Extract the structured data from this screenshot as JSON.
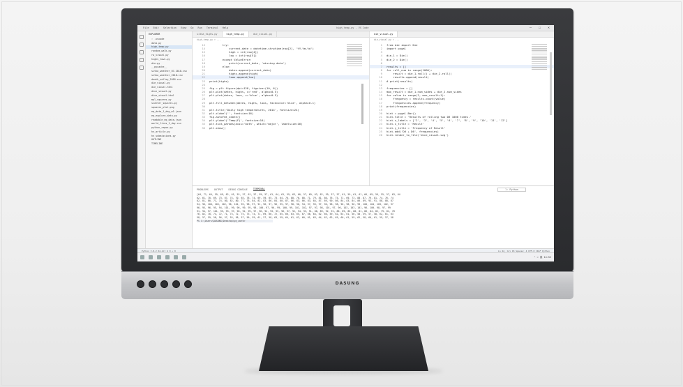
{
  "monitor": {
    "brand": "DASUNG",
    "buttons": [
      "",
      "",
      "",
      "",
      ""
    ]
  },
  "window": {
    "menu": [
      "File",
      "Edit",
      "Selection",
      "View",
      "Go",
      "Run",
      "Terminal",
      "Help"
    ],
    "title": "high_temp.py - VS Code",
    "controls": [
      "—",
      "☐",
      "✕"
    ]
  },
  "explorer": {
    "header": "EXPLORER",
    "items": [
      "› .vscode",
      "data.py",
      "high_temp.py",
      "random_walk.py",
      "rw_visual.py",
      "highs_lows.py",
      "die.py",
      "__pycache__",
      "sitka_weather_07-2018.csv",
      "sitka_weather_2018.csv",
      "death_valley_2018.csv",
      "die_visual.py",
      "die_visual.html",
      "dice_visual.py",
      "dice_visual.html",
      "mpl_squares.py",
      "scatter_squares.py",
      "squares_plot.png",
      "eq_data_1_day_m1.json",
      "eq_explore_data.py",
      "readable_eq_data.json",
      "world_fires_1_day.csv",
      "python_repos.py",
      "hn_article.py",
      "hn_submissions.py",
      "OUTLINE",
      "TIMELINE"
    ]
  },
  "editor_left": {
    "tabs": [
      "sitka_highs.py",
      "high_temp.py",
      "die_visual.py"
    ],
    "breadcrumb": "high_temp.py > ...",
    "lines": [
      {
        "n": "13",
        "t": "        try:"
      },
      {
        "n": "14",
        "t": "            current_date = datetime.strptime(row[2], '%Y-%m-%d')"
      },
      {
        "n": "15",
        "t": "            high = int(row[4])"
      },
      {
        "n": "16",
        "t": "            low = int(row[5])"
      },
      {
        "n": "17",
        "t": "        except ValueError:"
      },
      {
        "n": "18",
        "t": "            print(current_date, 'missing data')"
      },
      {
        "n": "19",
        "t": "        else:"
      },
      {
        "n": "20",
        "t": "            dates.append(current_date)"
      },
      {
        "n": "21",
        "t": "            highs.append(high)"
      },
      {
        "n": "22",
        "t": "            lows.append(low)"
      },
      {
        "n": "23",
        "t": "print(highs)"
      },
      {
        "n": "24",
        "t": ""
      },
      {
        "n": "25",
        "t": "fig = plt.figure(dpi=128, figsize=(10, 6))"
      },
      {
        "n": "26",
        "t": "plt.plot(dates, highs, c='red', alpha=0.5)"
      },
      {
        "n": "27",
        "t": "plt.plot(dates, lows, c='blue', alpha=0.5)"
      },
      {
        "n": "28",
        "t": ""
      },
      {
        "n": "29",
        "t": "plt.fill_between(dates, highs, lows, facecolor='blue', alpha=0.1)"
      },
      {
        "n": "30",
        "t": ""
      },
      {
        "n": "31",
        "t": "plt.title('Daily high temperatures, 2014', fontsize=24)"
      },
      {
        "n": "32",
        "t": "plt.xlabel('', fontsize=16)"
      },
      {
        "n": "33",
        "t": "fig.autofmt_xdate()"
      },
      {
        "n": "34",
        "t": "plt.ylabel('Temp(F)', fontsize=16)"
      },
      {
        "n": "35",
        "t": "plt.tick_params(axis='both', which='major', labelsize=16)"
      },
      {
        "n": "36",
        "t": "plt.show()"
      }
    ]
  },
  "editor_right": {
    "tabs": [
      "die_visual.py"
    ],
    "breadcrumb": "die_visual.py > ...",
    "lines": [
      {
        "n": "1",
        "t": "from die import Die"
      },
      {
        "n": "2",
        "t": "import pygal"
      },
      {
        "n": "3",
        "t": ""
      },
      {
        "n": "4",
        "t": "die_1 = Die()"
      },
      {
        "n": "5",
        "t": "die_2 = Die()"
      },
      {
        "n": "6",
        "t": ""
      },
      {
        "n": "7",
        "t": "results = []"
      },
      {
        "n": "8",
        "t": "for roll_num in range(1000):"
      },
      {
        "n": "9",
        "t": "    result = die_1.roll() + die_2.roll()"
      },
      {
        "n": "10",
        "t": "    results.append(result)"
      },
      {
        "n": "11",
        "t": "# print(results)"
      },
      {
        "n": "12",
        "t": ""
      },
      {
        "n": "13",
        "t": "frequencies = []"
      },
      {
        "n": "14",
        "t": "max_result = die_1.num_sides + die_2.num_sides"
      },
      {
        "n": "15",
        "t": "for value in range(2, max_result+1):"
      },
      {
        "n": "16",
        "t": "    frequency = results.count(value)"
      },
      {
        "n": "17",
        "t": "    frequencies.append(frequency)"
      },
      {
        "n": "18",
        "t": "print(frequencies)"
      },
      {
        "n": "19",
        "t": ""
      },
      {
        "n": "20",
        "t": "hist = pygal.Bar()"
      },
      {
        "n": "21",
        "t": "hist.title = 'Results of rolling two D6 1000 times.'"
      },
      {
        "n": "22",
        "t": "hist.x_labels = ['2', '3', '4', '5', '6', '7', '8', '9', '10', '11', '12']"
      },
      {
        "n": "23",
        "t": "hist.x_title = 'Result'"
      },
      {
        "n": "24",
        "t": "hist.y_title = 'Frequency of Result'"
      },
      {
        "n": "25",
        "t": "hist.add('D6 + D6', frequencies)"
      },
      {
        "n": "26",
        "t": "hist.render_to_file('dice_visual.svg')"
      }
    ]
  },
  "panel": {
    "tabs": [
      "PROBLEMS",
      "OUTPUT",
      "DEBUG CONSOLE",
      "TERMINAL"
    ],
    "terminal_select": "1: Python",
    "lines": [
      "[64, 71, 64, 59, 69, 62, 61, 55, 57, 61, 57, 59, 57, 61, 64, 61, 59, 63, 60, 57, 69, 63, 62, 59, 57, 57, 61, 59, 61, 61, 66, 69, 59, 55, 57, 63, 64",
      "62, 61, 70, 69, 73, 67, 74, 70, 65, 78, 74, 69, 59, 65, 73, 64, 70, 80, 76, 80, 71, 79, 81, 80, 76, 75, 71, 69, 73, 80, 87, 79, 81, 74, 76, 74",
      "82, 81, 80, 71, 74, 80, 82, 80, 77, 78, 84, 82, 83, 86, 84, 80, 87, 86, 83, 86, 83, 84, 87, 89, 90, 86, 84, 83, 84, 86, 89, 93, 91, 88, 88, 87",
      "94, 96, 100, 105, 102, 96, 101, 95, 98, 97, 91, 96, 97, 96, 95, 97, 98, 96, 94, 97, 93, 97, 96, 98, 98, 96, 98, 96, 99, 100, 104, 103, 102, 97",
      "96, 95, 96, 95, 94, 101, 99, 96, 99, 95, 98, 100, 97, 96, 99, 100, 99, 101, 102, 97, 97, 98, 101, 97, 96, 102, 103, 101, 96, 100, 98, 97, 99",
      "91, 94, 97, 101, 95, 93, 97, 96, 92, 99, 97, 96, 94, 93, 95, 96, 97, 92, 94, 93, 91, 88, 89, 92, 91, 86, 89, 85, 88, 81, 86, 84, 82, 79, 81, 78",
      "76, 82, 78, 74, 72, 71, 73, 72, 75, 73, 74, 71, 69, 66, 72, 65, 66, 63, 65, 67, 66, 64, 62, 60, 59, 62, 63, 61, 56, 58, 59, 57, 58, 62, 61, 63",
      "58, 57, 59, 58, 56, 57, 55, 58, 57, 56, 59, 61, 57, 58, 63, 59, 64, 61, 62, 60, 61, 63, 64, 62, 63, 65, 60, 61, 59, 62, 58, 60, 61, 59, 57, 58"
    ],
    "prompt": "PS C:\\Users\\DASUNG\\Desktop\\py_work>"
  },
  "statusbar": {
    "left": "Python 3.8.2 64-bit    ⊗ 0  ⚠ 0",
    "right": "Ln 22, Col 18   Spaces: 4   UTF-8   CRLF   Python"
  },
  "taskbar": {
    "clock": "⌃  ⌨  英  14:52"
  }
}
